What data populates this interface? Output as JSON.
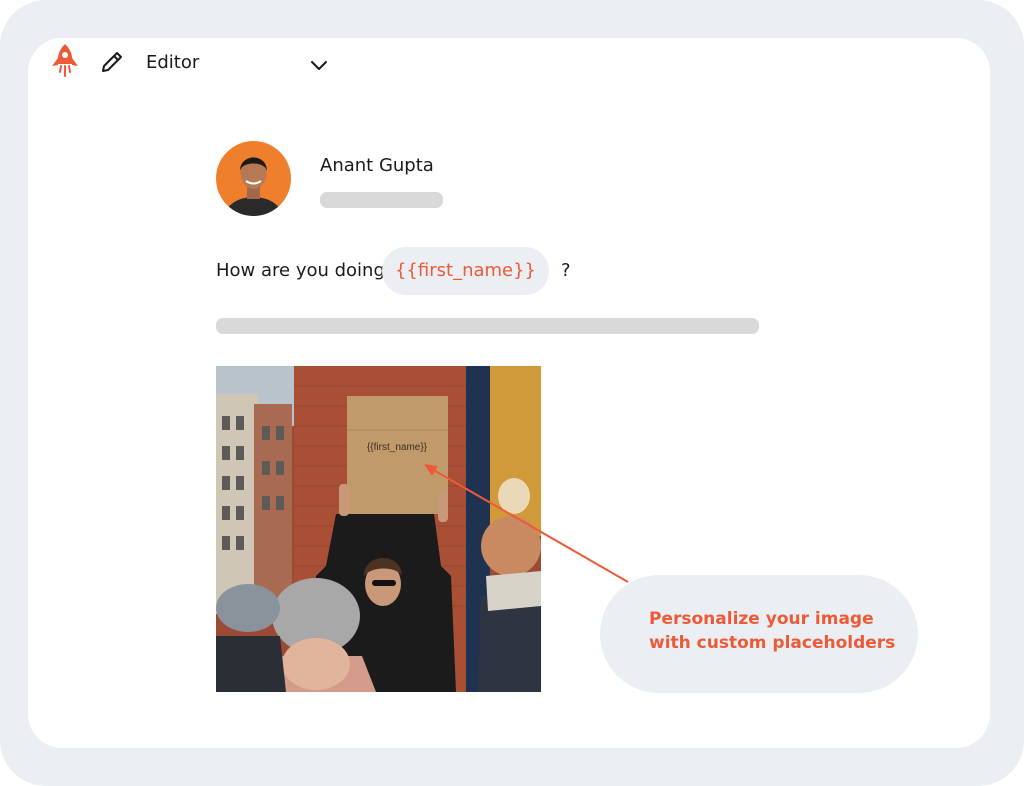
{
  "toolbar": {
    "logo_icon": "rocket-icon",
    "edit_icon": "pencil-icon",
    "mode_label": "Editor",
    "dropdown_icon": "chevron-down-icon"
  },
  "post": {
    "author_name": "Anant Gupta",
    "message_prefix": "How are you doing",
    "placeholder": "{{first_name}}",
    "message_suffix": "?",
    "image_sign_text": "{{first_name}}"
  },
  "callout": {
    "line1": "Personalize your image",
    "line2": "with custom placeholders"
  },
  "colors": {
    "accent": "#ee5a37",
    "frame": "#ebeff3",
    "avatar_bg": "#ef7f2c",
    "skeleton": "#d9d9d9"
  }
}
